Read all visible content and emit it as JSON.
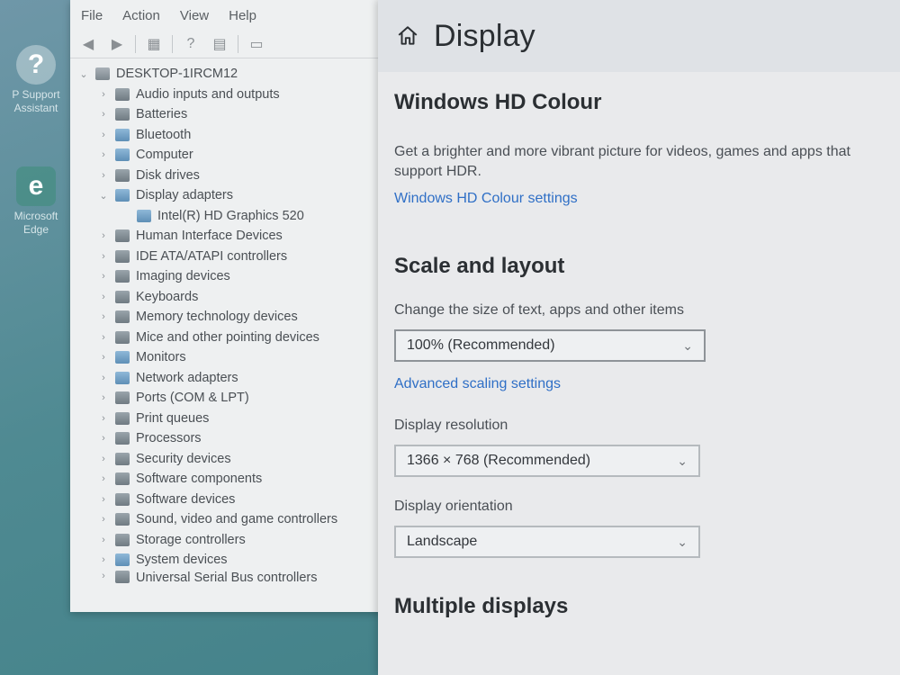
{
  "desktop": {
    "icons": [
      {
        "label_line1": "P Support",
        "label_line2": "Assistant"
      },
      {
        "label_line1": "Microsoft",
        "label_line2": "Edge"
      }
    ]
  },
  "device_manager": {
    "menu": [
      "File",
      "Action",
      "View",
      "Help"
    ],
    "computer_name": "DESKTOP-1IRCM12",
    "categories": [
      {
        "label": "Audio inputs and outputs",
        "expanded": false
      },
      {
        "label": "Batteries",
        "expanded": false
      },
      {
        "label": "Bluetooth",
        "expanded": false
      },
      {
        "label": "Computer",
        "expanded": false
      },
      {
        "label": "Disk drives",
        "expanded": false
      },
      {
        "label": "Display adapters",
        "expanded": true,
        "child": "Intel(R) HD Graphics 520"
      },
      {
        "label": "Human Interface Devices",
        "expanded": false
      },
      {
        "label": "IDE ATA/ATAPI controllers",
        "expanded": false
      },
      {
        "label": "Imaging devices",
        "expanded": false
      },
      {
        "label": "Keyboards",
        "expanded": false
      },
      {
        "label": "Memory technology devices",
        "expanded": false
      },
      {
        "label": "Mice and other pointing devices",
        "expanded": false
      },
      {
        "label": "Monitors",
        "expanded": false
      },
      {
        "label": "Network adapters",
        "expanded": false
      },
      {
        "label": "Ports (COM & LPT)",
        "expanded": false
      },
      {
        "label": "Print queues",
        "expanded": false
      },
      {
        "label": "Processors",
        "expanded": false
      },
      {
        "label": "Security devices",
        "expanded": false
      },
      {
        "label": "Software components",
        "expanded": false
      },
      {
        "label": "Software devices",
        "expanded": false
      },
      {
        "label": "Sound, video and game controllers",
        "expanded": false
      },
      {
        "label": "Storage controllers",
        "expanded": false
      },
      {
        "label": "System devices",
        "expanded": false
      },
      {
        "label": "Universal Serial Bus controllers",
        "expanded": false
      }
    ]
  },
  "settings": {
    "page_title": "Display",
    "hdr": {
      "title": "Windows HD Colour",
      "description": "Get a brighter and more vibrant picture for videos, games and apps that support HDR.",
      "link": "Windows HD Colour settings"
    },
    "scale": {
      "title": "Scale and layout",
      "size_label": "Change the size of text, apps and other items",
      "size_value": "100% (Recommended)",
      "advanced_link": "Advanced scaling settings",
      "resolution_label": "Display resolution",
      "resolution_value": "1366 × 768 (Recommended)",
      "orientation_label": "Display orientation",
      "orientation_value": "Landscape"
    },
    "multiple_displays_title": "Multiple displays"
  }
}
